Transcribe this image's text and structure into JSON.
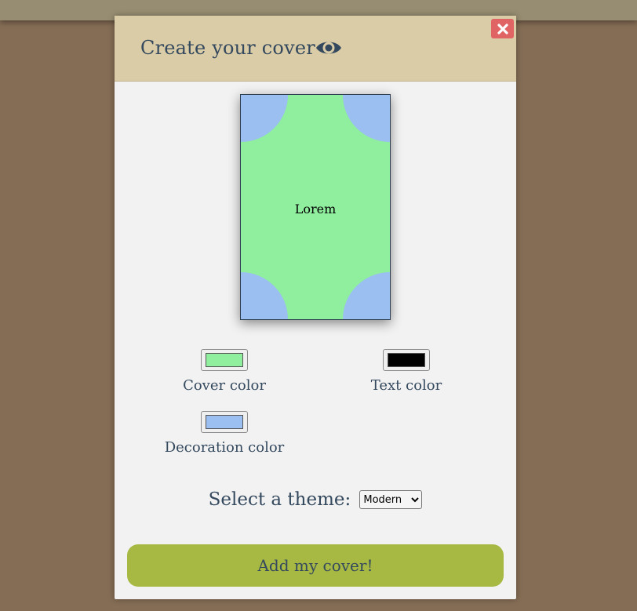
{
  "modal": {
    "title": "Create your cover",
    "header_icon": "eye-icon",
    "close_icon": "close-icon"
  },
  "preview": {
    "cover_text": "Lorem"
  },
  "colors": {
    "cover": "#90ee9f",
    "text": "#000000",
    "decoration": "#9abff0",
    "header_bg": "#dacca6",
    "close_bg": "#e06464",
    "button_bg": "#a7b942",
    "page_bg": "#856d55"
  },
  "controls": {
    "cover_color_label": "Cover color",
    "text_color_label": "Text color",
    "decoration_color_label": "Decoration color",
    "theme_label": "Select a theme:",
    "theme_selected": "Modern",
    "submit_label": "Add my cover!"
  }
}
